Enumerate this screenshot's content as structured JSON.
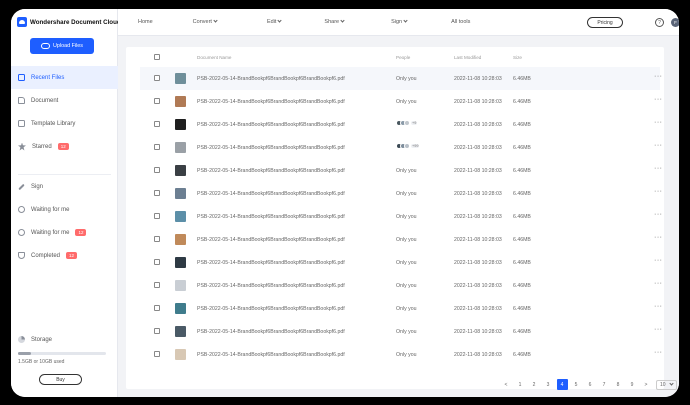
{
  "app": {
    "name": "Wondershare Document Cloud"
  },
  "sidebar": {
    "upload_label": "Upload Files",
    "items": [
      {
        "label": "Recent Files",
        "icon": "recent-files-icon",
        "active": true
      },
      {
        "label": "Document",
        "icon": "folder-icon"
      },
      {
        "label": "Template Library",
        "icon": "template-icon"
      },
      {
        "label": "Starred",
        "icon": "star-icon",
        "badge": "12"
      },
      {
        "label": "Sign",
        "icon": "pen-icon"
      },
      {
        "label": "Waiting for me",
        "icon": "person-icon"
      },
      {
        "label": "Waiting for me",
        "icon": "people-icon",
        "badge": "12"
      },
      {
        "label": "Completed",
        "icon": "shield-icon",
        "badge": "12"
      }
    ],
    "storage": {
      "label": "Storage",
      "text": "1.5GB or 10GB used",
      "used_fraction": 0.15
    },
    "buy_label": "Buy"
  },
  "header": {
    "nav": [
      {
        "label": "Home",
        "dropdown": false
      },
      {
        "label": "Convert",
        "dropdown": true
      },
      {
        "label": "Edit",
        "dropdown": true
      },
      {
        "label": "Share",
        "dropdown": true
      },
      {
        "label": "Sign",
        "dropdown": true
      },
      {
        "label": "All tools",
        "dropdown": false
      }
    ],
    "pricing_label": "Pricing",
    "help_glyph": "?",
    "avatar_initial": "F"
  },
  "table": {
    "columns": {
      "name": "Document Name",
      "people": "People",
      "modified": "Last Modified",
      "size": "Size"
    },
    "rows": [
      {
        "name": "PSB-2022-05-14-BrandBookpf6BrandBookpf6BrandBookpf6.pdf",
        "people": "Only you",
        "modified": "2022-11-08 10:28:03",
        "size": "6.46MB",
        "thumb": "#6f8f9a"
      },
      {
        "name": "PSB-2022-05-14-BrandBookpf6BrandBookpf6BrandBookpf6.pdf",
        "people": "Only you",
        "modified": "2022-11-08 10:28:03",
        "size": "6.46MB",
        "thumb": "#b07a55"
      },
      {
        "name": "PSB-2022-05-14-BrandBookpf6BrandBookpf6BrandBookpf6.pdf",
        "people": "",
        "avatars": [
          "#49575f",
          "#8a9aa8",
          "#c0c6cc"
        ],
        "more": "+9",
        "modified": "2022-11-08 10:28:03",
        "size": "6.46MB",
        "thumb": "#1f1f1f"
      },
      {
        "name": "PSB-2022-05-14-BrandBookpf6BrandBookpf6BrandBookpf6.pdf",
        "people": "",
        "avatars": [
          "#3c4a55",
          "#7d8d9c",
          "#b8c0c8"
        ],
        "more": "+99",
        "modified": "2022-11-08 10:28:03",
        "size": "6.46MB",
        "thumb": "#9aa0a6"
      },
      {
        "name": "PSB-2022-05-14-BrandBookpf6BrandBookpf6BrandBookpf6.pdf",
        "people": "Only you",
        "modified": "2022-11-08 10:28:03",
        "size": "6.46MB",
        "thumb": "#3a3f44"
      },
      {
        "name": "PSB-2022-05-14-BrandBookpf6BrandBookpf6BrandBookpf6.pdf",
        "people": "Only you",
        "modified": "2022-11-08 10:28:03",
        "size": "6.46MB",
        "thumb": "#6c7f92"
      },
      {
        "name": "PSB-2022-05-14-BrandBookpf6BrandBookpf6BrandBookpf6.pdf",
        "people": "Only you",
        "modified": "2022-11-08 10:28:03",
        "size": "6.46MB",
        "thumb": "#5c8fa8"
      },
      {
        "name": "PSB-2022-05-14-BrandBookpf6BrandBookpf6BrandBookpf6.pdf",
        "people": "Only you",
        "modified": "2022-11-08 10:28:03",
        "size": "6.46MB",
        "thumb": "#c08a5a"
      },
      {
        "name": "PSB-2022-05-14-BrandBookpf6BrandBookpf6BrandBookpf6.pdf",
        "people": "Only you",
        "modified": "2022-11-08 10:28:03",
        "size": "6.46MB",
        "thumb": "#2e3a44"
      },
      {
        "name": "PSB-2022-05-14-BrandBookpf6BrandBookpf6BrandBookpf6.pdf",
        "people": "Only you",
        "modified": "2022-11-08 10:28:03",
        "size": "6.46MB",
        "thumb": "#c9ced4"
      },
      {
        "name": "PSB-2022-05-14-BrandBookpf6BrandBookpf6BrandBookpf6.pdf",
        "people": "Only you",
        "modified": "2022-11-08 10:28:03",
        "size": "6.46MB",
        "thumb": "#3f7c8c"
      },
      {
        "name": "PSB-2022-05-14-BrandBookpf6BrandBookpf6BrandBookpf6.pdf",
        "people": "Only you",
        "modified": "2022-11-08 10:28:03",
        "size": "6.46MB",
        "thumb": "#4a5a66"
      },
      {
        "name": "PSB-2022-05-14-BrandBookpf6BrandBookpf6BrandBookpf6.pdf",
        "people": "Only you",
        "modified": "2022-11-08 10:28:03",
        "size": "6.46MB",
        "thumb": "#d8c8b4"
      }
    ]
  },
  "pagination": {
    "prev": "<",
    "pages": [
      "1",
      "2",
      "3",
      "4",
      "5",
      "6",
      "7",
      "8",
      "9"
    ],
    "current": "4",
    "next": ">",
    "page_size": "10"
  },
  "colors": {
    "accent": "#1e5eff",
    "badge": "#ff6b6b"
  }
}
